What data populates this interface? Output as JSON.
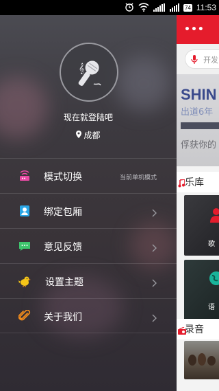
{
  "status_bar": {
    "time": "11:53",
    "battery_level": "74",
    "icons": [
      "alarm-icon",
      "wifi-icon",
      "signal-icon",
      "battery-icon"
    ]
  },
  "drawer": {
    "login_prompt": "现在就登陆吧",
    "location": "成都",
    "menu": [
      {
        "label": "模式切换",
        "hint": "当前单机模式",
        "icon": "mode-switch-icon",
        "color": "#e94aa4"
      },
      {
        "label": "绑定包厢",
        "hint": "",
        "icon": "bind-room-icon",
        "color": "#2aa6e6"
      },
      {
        "label": "意见反馈",
        "hint": "",
        "icon": "feedback-icon",
        "color": "#3ec46d"
      },
      {
        "label": "设置主题",
        "hint": "",
        "icon": "theme-bird-icon",
        "color": "#f5c518"
      },
      {
        "label": "关于我们",
        "hint": "",
        "icon": "paperclip-icon",
        "color": "#f08a1c"
      }
    ]
  },
  "main": {
    "menu_dots": "•••",
    "search_placeholder": "开发",
    "banner": {
      "title": "SHIN",
      "subtitle": "出道6年",
      "caption": "俘获你的"
    },
    "sections": {
      "library": "乐库",
      "recordings": "录音"
    },
    "tiles": {
      "singer": "歌",
      "language": "语"
    },
    "accent_color": "#e51c2c"
  }
}
